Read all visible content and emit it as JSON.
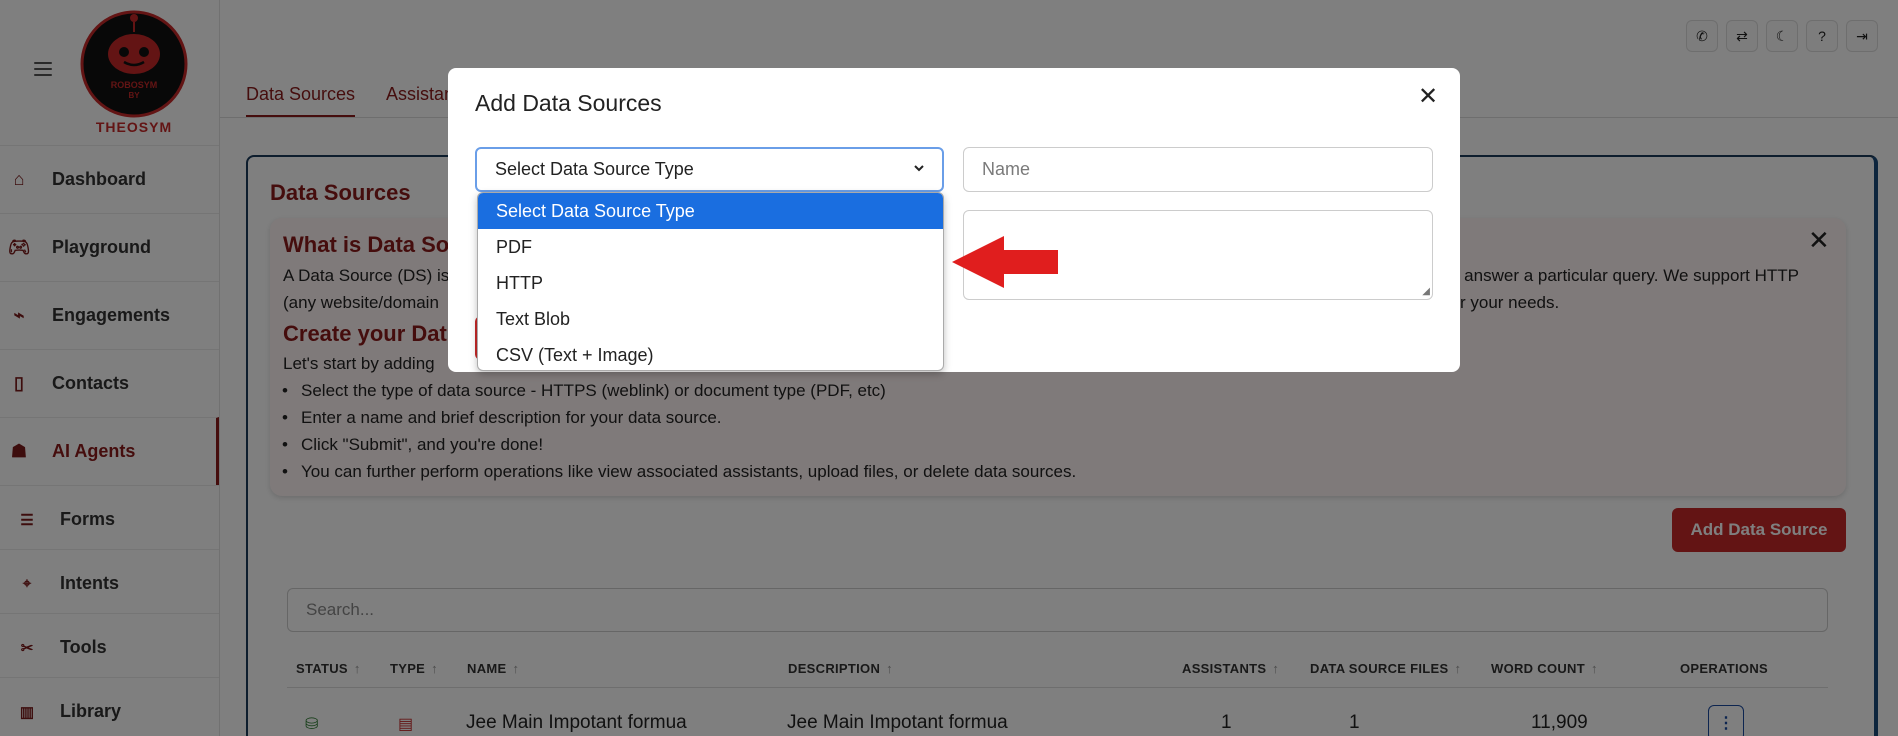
{
  "logo": {
    "text_line1": "ROBOSYM",
    "text_line2": "BY",
    "brand": "THEOSYM"
  },
  "sidebar": {
    "items": [
      {
        "label": "Dashboard",
        "icon": "home-icon"
      },
      {
        "label": "Playground",
        "icon": "gamepad-icon"
      },
      {
        "label": "Engagements",
        "icon": "activity-icon"
      },
      {
        "label": "Contacts",
        "icon": "contact-card-icon"
      },
      {
        "label": "AI Agents",
        "icon": "robot-icon",
        "active": true
      },
      {
        "label": "Forms",
        "icon": "list-icon"
      },
      {
        "label": "Intents",
        "icon": "target-icon"
      },
      {
        "label": "Tools",
        "icon": "tools-icon"
      },
      {
        "label": "Library",
        "icon": "library-icon"
      }
    ]
  },
  "topbar": {
    "icons": [
      "phone-icon",
      "translate-icon",
      "moon-icon",
      "help-icon",
      "logout-icon"
    ]
  },
  "tabs": [
    {
      "label": "Data Sources",
      "active": true
    },
    {
      "label": "Assistan"
    }
  ],
  "page": {
    "title": "Data Sources",
    "info": {
      "heading1": "What is Data So",
      "para1_line1": "A Data Source (DS) is",
      "para1_line1_end": "o answer a particular query. We support HTTP",
      "para1_line2": "(any website/domain",
      "para1_line2_end": "r your needs.",
      "heading2": "Create your Dat",
      "intro": "Let's start by adding",
      "bullets": [
        "Select the type of data source - HTTPS (weblink) or document type (PDF, etc)",
        "Enter a name and brief description for your data source.",
        "Click \"Submit\", and you're done!",
        "You can further perform operations like view associated assistants, upload files, or delete data sources."
      ]
    },
    "add_button": "Add Data Source",
    "search_placeholder": "Search...",
    "table": {
      "headers": [
        "STATUS",
        "TYPE",
        "NAME",
        "DESCRIPTION",
        "ASSISTANTS",
        "DATA SOURCE FILES",
        "WORD COUNT",
        "OPERATIONS"
      ],
      "sort_glyph": "↑",
      "rows": [
        {
          "name": "Jee Main Impotant formua",
          "description": "Jee Main Impotant formua",
          "assistants": "1",
          "files": "1",
          "word_count": "11,909",
          "ops_glyph": "⋮"
        }
      ]
    }
  },
  "modal": {
    "title": "Add Data Sources",
    "close_glyph": "✕",
    "select_value": "Select Data Source Type",
    "name_placeholder": "Name",
    "options": [
      "Select Data Source Type",
      "PDF",
      "HTTP",
      "Text Blob",
      "CSV (Text + Image)"
    ]
  },
  "colors": {
    "accent": "#8b1a1a",
    "button": "#c62828",
    "selected_option": "#1a6ee0",
    "arrow": "#e01e1e"
  }
}
